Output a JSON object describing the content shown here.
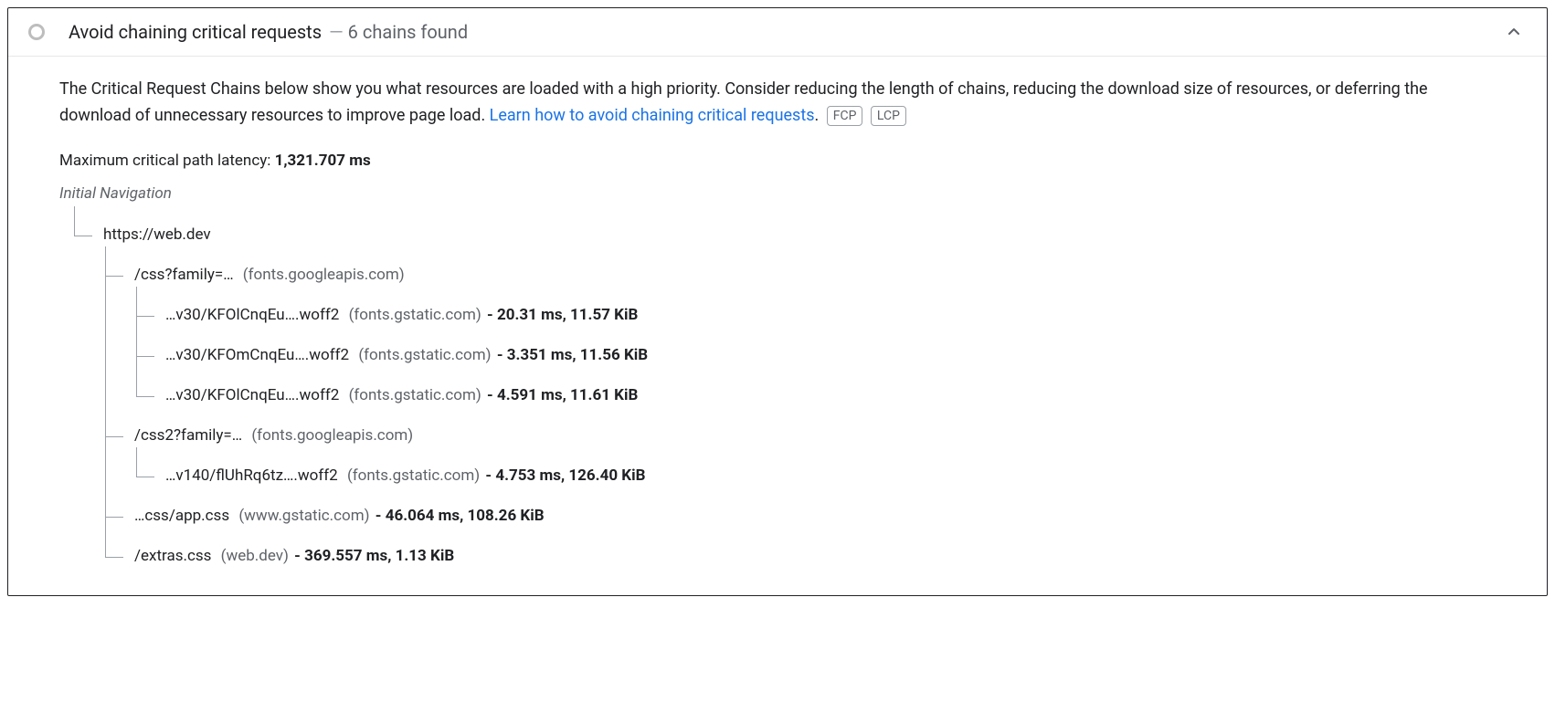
{
  "header": {
    "title": "Avoid chaining critical requests",
    "subtitle": "6 chains found",
    "dash": "—"
  },
  "description": {
    "text1": "The Critical Request Chains below show you what resources are loaded with a high priority. Consider reducing the length of chains, reducing the download size of resources, or deferring the download of unnecessary resources to improve page load. ",
    "link_text": "Learn how to avoid chaining critical requests",
    "period": ".",
    "badge_fcp": "FCP",
    "badge_lcp": "LCP"
  },
  "latency": {
    "label": "Maximum critical path latency: ",
    "value": "1,321.707 ms"
  },
  "root_label": "Initial Navigation",
  "tree": {
    "n0": {
      "url": "https://web.dev",
      "host": "",
      "stats": ""
    },
    "n1": {
      "url": "/css?family=…",
      "host": "(fonts.googleapis.com)",
      "stats": ""
    },
    "n2": {
      "url": "…v30/KFOlCnqEu….woff2",
      "host": "(fonts.gstatic.com)",
      "stats": "- 20.31 ms, 11.57 KiB"
    },
    "n3": {
      "url": "…v30/KFOmCnqEu….woff2",
      "host": "(fonts.gstatic.com)",
      "stats": "- 3.351 ms, 11.56 KiB"
    },
    "n4": {
      "url": "…v30/KFOlCnqEu….woff2",
      "host": "(fonts.gstatic.com)",
      "stats": "- 4.591 ms, 11.61 KiB"
    },
    "n5": {
      "url": "/css2?family=…",
      "host": "(fonts.googleapis.com)",
      "stats": ""
    },
    "n6": {
      "url": "…v140/flUhRq6tz….woff2",
      "host": "(fonts.gstatic.com)",
      "stats": "- 4.753 ms, 126.40 KiB"
    },
    "n7": {
      "url": "…css/app.css",
      "host": "(www.gstatic.com)",
      "stats": "- 46.064 ms, 108.26 KiB"
    },
    "n8": {
      "url": "/extras.css",
      "host": "(web.dev)",
      "stats": "- 369.557 ms, 1.13 KiB"
    }
  }
}
